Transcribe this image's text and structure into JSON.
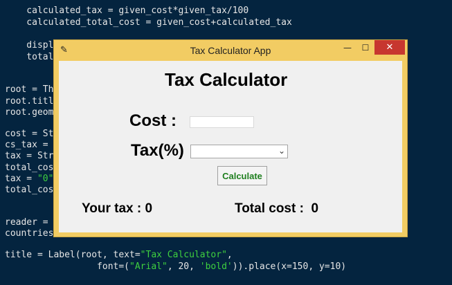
{
  "background_code": [
    {
      "segments": [
        {
          "text": "    calculated_tax = given_cost*given_tax/100"
        }
      ]
    },
    {
      "segments": [
        {
          "text": "    calculated_total_cost = given_cost+calculated_tax"
        }
      ]
    },
    {
      "segments": [
        {
          "text": "    displ"
        }
      ]
    },
    {
      "segments": [
        {
          "text": "    total"
        }
      ]
    },
    {
      "segments": [
        {
          "text": "root = Th"
        }
      ]
    },
    {
      "segments": [
        {
          "text": "root.titl"
        }
      ]
    },
    {
      "segments": [
        {
          "text": "root.geom"
        }
      ]
    },
    {
      "segments": [
        {
          "text": "cost = St"
        }
      ]
    },
    {
      "segments": [
        {
          "text": "cs_tax = "
        }
      ]
    },
    {
      "segments": [
        {
          "text": "tax = Str"
        }
      ]
    },
    {
      "segments": [
        {
          "text": "total_cos"
        }
      ]
    },
    {
      "segments": [
        {
          "text": "tax = "
        },
        {
          "text": "\"0\"",
          "cls": "str"
        }
      ]
    },
    {
      "segments": [
        {
          "text": "total_cos"
        }
      ]
    },
    {
      "segments": [
        {
          "text": "reader = "
        }
      ]
    },
    {
      "segments": [
        {
          "text": "countries"
        }
      ]
    },
    {
      "segments": [
        {
          "text": "title = Label(root, text="
        },
        {
          "text": "\"Tax Calculator\"",
          "cls": "str"
        },
        {
          "text": ","
        }
      ]
    },
    {
      "segments": [
        {
          "text": "                 font=("
        },
        {
          "text": "\"Arial\"",
          "cls": "str"
        },
        {
          "text": ", 20, "
        },
        {
          "text": "'bold'",
          "cls": "str"
        },
        {
          "text": ")).place(x=150, y=10)"
        }
      ]
    }
  ],
  "window": {
    "title": "Tax Calculator App",
    "icon": "feather-icon",
    "buttons": {
      "minimize": "—",
      "maximize": "☐",
      "close": "✕"
    }
  },
  "app": {
    "heading": "Tax Calculator",
    "cost_label": "Cost :",
    "cost_value": "",
    "tax_label": "Tax(%)",
    "tax_selected": "",
    "calculate_label": "Calculate",
    "your_tax_text": "Your tax : 0",
    "total_cost_text": "Total cost :  0"
  },
  "colors": {
    "desktop_bg": "#04243f",
    "window_frame": "#f2cc63",
    "close_button": "#c7372f",
    "calculate_text": "#1f7f1f",
    "code_string": "#3fd03f"
  }
}
